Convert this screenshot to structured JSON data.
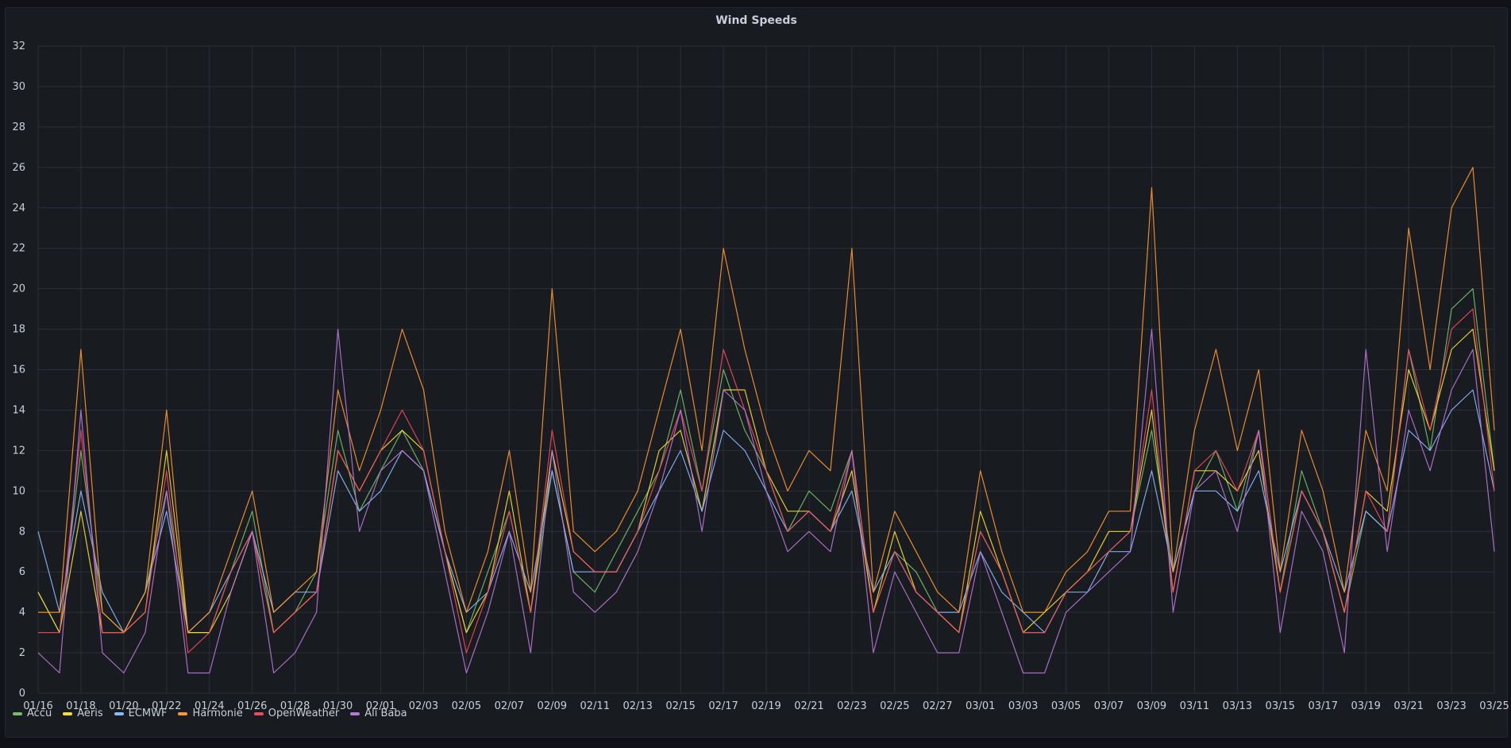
{
  "chart_data": {
    "type": "line",
    "title": "Wind Speeds",
    "xlabel": "",
    "ylabel": "",
    "ylim": [
      0,
      32
    ],
    "yticks": [
      0,
      2,
      4,
      6,
      8,
      10,
      12,
      14,
      16,
      18,
      20,
      22,
      24,
      26,
      28,
      30,
      32
    ],
    "x_tick_labels": [
      "01/16",
      "01/18",
      "01/20",
      "01/22",
      "01/24",
      "01/26",
      "01/28",
      "01/30",
      "02/01",
      "02/03",
      "02/05",
      "02/07",
      "02/09",
      "02/11",
      "02/13",
      "02/15",
      "02/17",
      "02/19",
      "02/21",
      "02/23",
      "02/25",
      "02/27",
      "03/01",
      "03/03",
      "03/05",
      "03/07",
      "03/09",
      "03/11",
      "03/13",
      "03/15",
      "03/17",
      "03/19",
      "03/21",
      "03/23",
      "03/25"
    ],
    "grid": true,
    "legend_position": "bottom-left",
    "x": [
      "01/16",
      "01/17",
      "01/18",
      "01/19",
      "01/20",
      "01/21",
      "01/22",
      "01/23",
      "01/24",
      "01/25",
      "01/26",
      "01/27",
      "01/28",
      "01/29",
      "01/30",
      "01/31",
      "02/01",
      "02/02",
      "02/03",
      "02/04",
      "02/05",
      "02/06",
      "02/07",
      "02/08",
      "02/09",
      "02/10",
      "02/11",
      "02/12",
      "02/13",
      "02/14",
      "02/15",
      "02/16",
      "02/17",
      "02/18",
      "02/19",
      "02/20",
      "02/21",
      "02/22",
      "02/23",
      "02/24",
      "02/25",
      "02/26",
      "02/27",
      "02/28",
      "03/01",
      "03/02",
      "03/03",
      "03/04",
      "03/05",
      "03/06",
      "03/07",
      "03/08",
      "03/09",
      "03/10",
      "03/11",
      "03/12",
      "03/13",
      "03/14",
      "03/15",
      "03/16",
      "03/17",
      "03/18",
      "03/19",
      "03/20",
      "03/21",
      "03/22",
      "03/23",
      "03/24",
      "03/25"
    ],
    "series": [
      {
        "name": "Accu",
        "color": "#73bf69",
        "values": [
          5,
          3,
          12,
          4,
          3,
          5,
          10,
          3,
          3,
          6,
          9,
          3,
          4,
          6,
          13,
          9,
          11,
          13,
          11,
          7,
          3,
          6,
          9,
          4,
          11,
          6,
          5,
          7,
          9,
          11,
          15,
          10,
          16,
          13,
          11,
          8,
          10,
          9,
          12,
          4,
          7,
          6,
          4,
          3,
          8,
          6,
          3,
          3,
          5,
          6,
          7,
          8,
          13,
          6,
          10,
          12,
          9,
          13,
          5,
          11,
          8,
          4,
          9,
          8,
          17,
          12,
          19,
          20,
          11
        ]
      },
      {
        "name": "Aeris",
        "color": "#fade2a",
        "values": [
          5,
          3,
          9,
          3,
          3,
          4,
          12,
          3,
          3,
          5,
          8,
          3,
          4,
          5,
          12,
          10,
          12,
          13,
          12,
          7,
          3,
          5,
          10,
          4,
          12,
          7,
          6,
          6,
          8,
          12,
          13,
          9,
          15,
          15,
          11,
          9,
          9,
          8,
          11,
          4,
          8,
          5,
          4,
          3,
          9,
          6,
          3,
          4,
          5,
          6,
          8,
          8,
          14,
          5,
          11,
          11,
          10,
          12,
          5,
          10,
          8,
          4,
          10,
          9,
          16,
          13,
          17,
          18,
          11
        ]
      },
      {
        "name": "ECMWF",
        "color": "#8ab8ff",
        "values": [
          8,
          4,
          10,
          5,
          3,
          5,
          9,
          3,
          4,
          6,
          8,
          4,
          5,
          5,
          11,
          9,
          10,
          12,
          11,
          7,
          4,
          5,
          8,
          5,
          11,
          6,
          6,
          6,
          8,
          10,
          12,
          9,
          13,
          12,
          10,
          8,
          9,
          8,
          10,
          5,
          7,
          5,
          4,
          4,
          7,
          5,
          4,
          3,
          5,
          5,
          7,
          7,
          11,
          6,
          10,
          10,
          9,
          11,
          6,
          10,
          8,
          5,
          9,
          8,
          13,
          12,
          14,
          15,
          10
        ]
      },
      {
        "name": "Harmonie",
        "color": "#ff9830",
        "values": [
          4,
          4,
          17,
          4,
          3,
          5,
          14,
          3,
          4,
          7,
          10,
          4,
          5,
          6,
          15,
          11,
          14,
          18,
          15,
          8,
          4,
          7,
          12,
          5,
          20,
          8,
          7,
          8,
          10,
          14,
          18,
          12,
          22,
          17,
          13,
          10,
          12,
          11,
          22,
          5,
          9,
          7,
          5,
          4,
          11,
          7,
          4,
          4,
          6,
          7,
          9,
          9,
          25,
          6,
          13,
          17,
          12,
          16,
          6,
          13,
          10,
          5,
          13,
          10,
          23,
          16,
          24,
          26,
          13
        ]
      },
      {
        "name": "OpenWeather",
        "color": "#f2495c",
        "values": [
          3,
          3,
          13,
          3,
          3,
          4,
          11,
          2,
          3,
          6,
          8,
          3,
          4,
          5,
          12,
          10,
          12,
          14,
          12,
          7,
          2,
          5,
          9,
          4,
          13,
          7,
          6,
          6,
          8,
          11,
          14,
          10,
          17,
          14,
          11,
          8,
          9,
          8,
          12,
          4,
          7,
          5,
          4,
          3,
          8,
          6,
          3,
          3,
          5,
          6,
          7,
          8,
          15,
          5,
          11,
          12,
          10,
          13,
          5,
          10,
          8,
          4,
          10,
          8,
          17,
          13,
          18,
          19,
          10
        ]
      },
      {
        "name": "Ali Baba",
        "color": "#b877d9",
        "values": [
          2,
          1,
          14,
          2,
          1,
          3,
          10,
          1,
          1,
          5,
          8,
          1,
          2,
          4,
          18,
          8,
          11,
          12,
          11,
          6,
          1,
          4,
          8,
          2,
          12,
          5,
          4,
          5,
          7,
          10,
          14,
          8,
          15,
          14,
          10,
          7,
          8,
          7,
          12,
          2,
          6,
          4,
          2,
          2,
          7,
          4,
          1,
          1,
          4,
          5,
          6,
          7,
          18,
          4,
          10,
          11,
          8,
          13,
          3,
          9,
          7,
          2,
          17,
          7,
          14,
          11,
          15,
          17,
          7
        ]
      }
    ]
  }
}
